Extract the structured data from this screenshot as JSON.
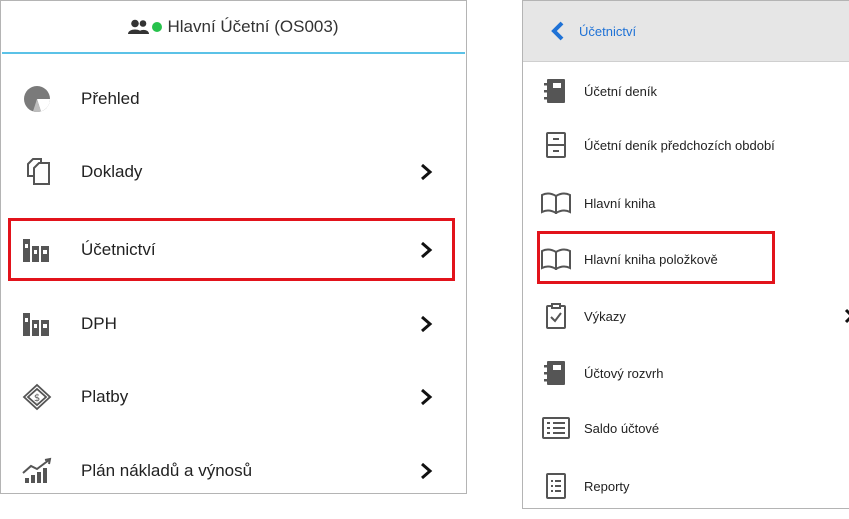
{
  "left_panel": {
    "header": {
      "title": "Hlavní Účetní (OS003)",
      "users_icon": "users-icon",
      "status_color": "#27c24c"
    },
    "items": [
      {
        "label": "Přehled",
        "icon": "pie-chart-icon",
        "has_submenu": false
      },
      {
        "label": "Doklady",
        "icon": "documents-icon",
        "has_submenu": true
      },
      {
        "label": "Účetnictví",
        "icon": "books-icon",
        "has_submenu": true,
        "highlighted": true
      },
      {
        "label": "DPH",
        "icon": "books-icon",
        "has_submenu": true
      },
      {
        "label": "Platby",
        "icon": "money-icon",
        "has_submenu": true
      },
      {
        "label": "Plán nákladů a výnosů",
        "icon": "growth-chart-icon",
        "has_submenu": true
      }
    ]
  },
  "right_panel": {
    "header": {
      "title": "Účetnictví",
      "back_icon": "back-chevron-icon",
      "title_color": "#1f72d6"
    },
    "items": [
      {
        "label": "Účetní deník",
        "icon": "notebook-icon"
      },
      {
        "label": "Účetní deník předchozích období",
        "icon": "archive-icon"
      },
      {
        "label": "Hlavní kniha",
        "icon": "open-book-icon"
      },
      {
        "label": "Hlavní kniha položkově",
        "icon": "open-book-icon",
        "highlighted": true
      },
      {
        "label": "Výkazy",
        "icon": "clipboard-check-icon",
        "has_submenu": true
      },
      {
        "label": "Účtový rozvrh",
        "icon": "notebook-icon"
      },
      {
        "label": "Saldo účtové",
        "icon": "list-icon"
      },
      {
        "label": "Reporty",
        "icon": "report-icon"
      }
    ]
  },
  "colors": {
    "highlight": "#e2131b",
    "header_accent": "#5bc2e7"
  }
}
